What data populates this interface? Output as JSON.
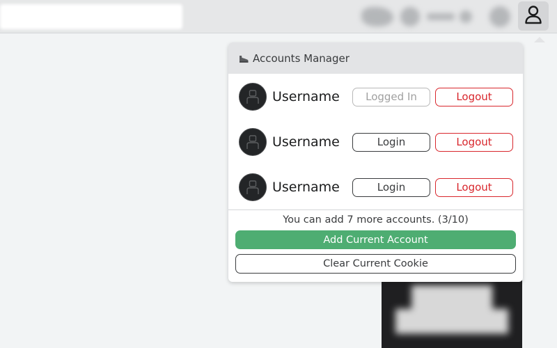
{
  "panel": {
    "title": "Accounts Manager",
    "header_icon": "sneaker-icon"
  },
  "accounts": [
    {
      "username": "Username",
      "primary_label": "Logged In",
      "primary_state": "logged-in",
      "logout_label": "Logout"
    },
    {
      "username": "Username",
      "primary_label": "Login",
      "primary_state": "login",
      "logout_label": "Logout"
    },
    {
      "username": "Username",
      "primary_label": "Login",
      "primary_state": "login",
      "logout_label": "Logout"
    }
  ],
  "footer": {
    "info": "You can add 7 more accounts. (3/10)",
    "add_label": "Add Current Account",
    "clear_label": "Clear Current Cookie"
  },
  "colors": {
    "accent_green": "#4ead72",
    "logout_red": "#d8262c",
    "topbar": "#e6e7e8",
    "header_bg": "#e3e4e6"
  },
  "icons": {
    "topbar_button": "user-icon",
    "avatar": "avatar-silhouette-icon"
  }
}
